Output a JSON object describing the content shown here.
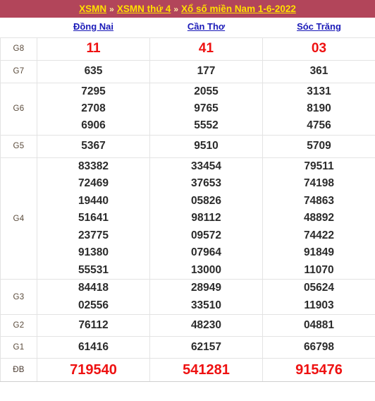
{
  "header": {
    "crumbs": [
      {
        "label": "XSMN",
        "type": "link"
      },
      {
        "label": "»",
        "type": "sep"
      },
      {
        "label": "XSMN thứ 4",
        "type": "link"
      },
      {
        "label": "»",
        "type": "sep"
      },
      {
        "label": "Xổ số miền Nam 1-6-2022",
        "type": "link"
      }
    ],
    "crumb_0": "XSMN",
    "sep_0": "»",
    "crumb_1": "XSMN thứ 4",
    "sep_1": "»",
    "crumb_2": "Xổ số miền Nam 1-6-2022",
    "bg_color": "#b2455a",
    "link_color": "#ffe000"
  },
  "table": {
    "provinces": [
      "Đồng Nai",
      "Cần Thơ",
      "Sóc Trăng"
    ],
    "province_0": "Đồng Nai",
    "province_1": "Cần Thơ",
    "province_2": "Sóc Trăng",
    "prize_labels": [
      "G8",
      "G7",
      "G6",
      "G5",
      "G4",
      "G3",
      "G2",
      "G1",
      "ĐB"
    ],
    "label_g8": "G8",
    "label_g7": "G7",
    "label_g6": "G6",
    "label_g5": "G5",
    "label_g4": "G4",
    "label_g3": "G3",
    "label_g2": "G2",
    "label_g1": "G1",
    "label_db": "ĐB",
    "highlight_color": "#ee1111",
    "text_color": "#2b2b2b",
    "rows": {
      "g8": {
        "dong_nai": [
          "11"
        ],
        "can_tho": [
          "41"
        ],
        "soc_trang": [
          "03"
        ]
      },
      "g7": {
        "dong_nai": [
          "635"
        ],
        "can_tho": [
          "177"
        ],
        "soc_trang": [
          "361"
        ]
      },
      "g6": {
        "dong_nai": [
          "7295",
          "2708",
          "6906"
        ],
        "can_tho": [
          "2055",
          "9765",
          "5552"
        ],
        "soc_trang": [
          "3131",
          "8190",
          "4756"
        ]
      },
      "g5": {
        "dong_nai": [
          "5367"
        ],
        "can_tho": [
          "9510"
        ],
        "soc_trang": [
          "5709"
        ]
      },
      "g4": {
        "dong_nai": [
          "83382",
          "72469",
          "19440",
          "51641",
          "23775",
          "91380",
          "55531"
        ],
        "can_tho": [
          "33454",
          "37653",
          "05826",
          "98112",
          "09572",
          "07964",
          "13000"
        ],
        "soc_trang": [
          "79511",
          "74198",
          "74863",
          "48892",
          "74422",
          "91849",
          "11070"
        ]
      },
      "g3": {
        "dong_nai": [
          "84418",
          "02556"
        ],
        "can_tho": [
          "28949",
          "33510"
        ],
        "soc_trang": [
          "05624",
          "11903"
        ]
      },
      "g2": {
        "dong_nai": [
          "76112"
        ],
        "can_tho": [
          "48230"
        ],
        "soc_trang": [
          "04881"
        ]
      },
      "g1": {
        "dong_nai": [
          "61416"
        ],
        "can_tho": [
          "62157"
        ],
        "soc_trang": [
          "66798"
        ]
      },
      "db": {
        "dong_nai": [
          "719540"
        ],
        "can_tho": [
          "541281"
        ],
        "soc_trang": [
          "915476"
        ]
      }
    }
  }
}
